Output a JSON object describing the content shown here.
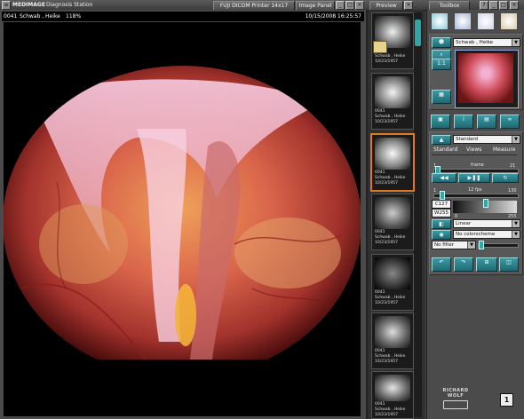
{
  "titlebar": {
    "app_name": "MEDIMAGE",
    "app_subtitle": "Diagnosis Station",
    "printer": "FUJI DICOM Printer 14x17",
    "image_panel": "Image Panel",
    "preview": "Preview",
    "toolbox": "Toolbox",
    "help": "?"
  },
  "viewer": {
    "patient_id": "0041",
    "patient_name": "Schwab , Heike",
    "zoom": "118%",
    "datetime": "10/15/2008 16:25:57"
  },
  "thumbnails": [
    {
      "id": "0041",
      "name": "Schwab , Heike",
      "date": "10/23/1957"
    },
    {
      "id": "0041",
      "name": "Schwab , Heike",
      "date": "10/23/1957"
    },
    {
      "id": "0041",
      "name": "Schwab , Heike",
      "date": "10/23/1957"
    },
    {
      "id": "0041",
      "name": "Schwab , Heike",
      "date": "10/23/1957"
    },
    {
      "id": "0041",
      "name": "Schwab , Heike",
      "date": "10/23/1957"
    },
    {
      "id": "0041",
      "name": "Schwab , Heike",
      "date": "10/23/1957"
    },
    {
      "id": "0041",
      "name": "Schwab , Heike",
      "date": "10/23/1957"
    }
  ],
  "toolbox": {
    "patient_select": "Schwab , Heike",
    "mode_select": "Standard",
    "tabs": [
      "Standard",
      "Views",
      "Measure"
    ],
    "frame_value": "1",
    "frame_label": "frame",
    "frame_max": "21",
    "fps_min": "1",
    "fps_label": "12 fps",
    "fps_max": "130",
    "contrast_label": "C127",
    "window_label": "W255",
    "range_min": "0",
    "range_max": "255",
    "lut_select": "Linear",
    "color_select": "No colorscheme",
    "filter_select": "No filter",
    "brand": "RICHARD WOLF",
    "accent": "#2ea6a6",
    "selected_border": "#e07a1f"
  }
}
